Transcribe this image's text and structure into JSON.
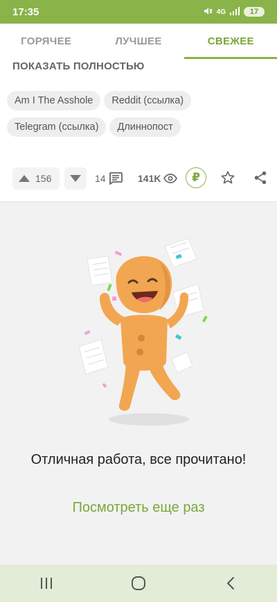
{
  "status_bar": {
    "time": "17:35",
    "network": "4G",
    "battery": "17"
  },
  "tabs": [
    {
      "label": "ГОРЯЧЕЕ"
    },
    {
      "label": "ЛУЧШЕЕ"
    },
    {
      "label": "СВЕЖЕЕ"
    }
  ],
  "active_tab": "СВЕЖЕЕ",
  "post": {
    "show_full_label": "ПОКАЗАТЬ ПОЛНОСТЬЮ",
    "tags": [
      "Am I The Asshole",
      "Reddit (ссылка)",
      "Telegram (ссылка)",
      "Длиннопост"
    ],
    "upvotes": "156",
    "comments": "14",
    "views": "141K",
    "donate_symbol": "₽"
  },
  "empty_state": {
    "message": "Отличная работа, все прочитано!",
    "action_label": "Посмотреть еще раз"
  },
  "colors": {
    "accent": "#8ab34a",
    "accent_text": "#7aa83a",
    "navbar_bg": "#e3ecd6"
  },
  "icons": {
    "upvote": "triangle-up-icon",
    "downvote": "triangle-down-icon",
    "comments": "comment-icon",
    "views": "eye-icon",
    "donate": "ruble-icon",
    "save": "star-icon",
    "share": "share-icon",
    "nav_recents": "recents-icon",
    "nav_home": "home-icon",
    "nav_back": "back-icon"
  }
}
